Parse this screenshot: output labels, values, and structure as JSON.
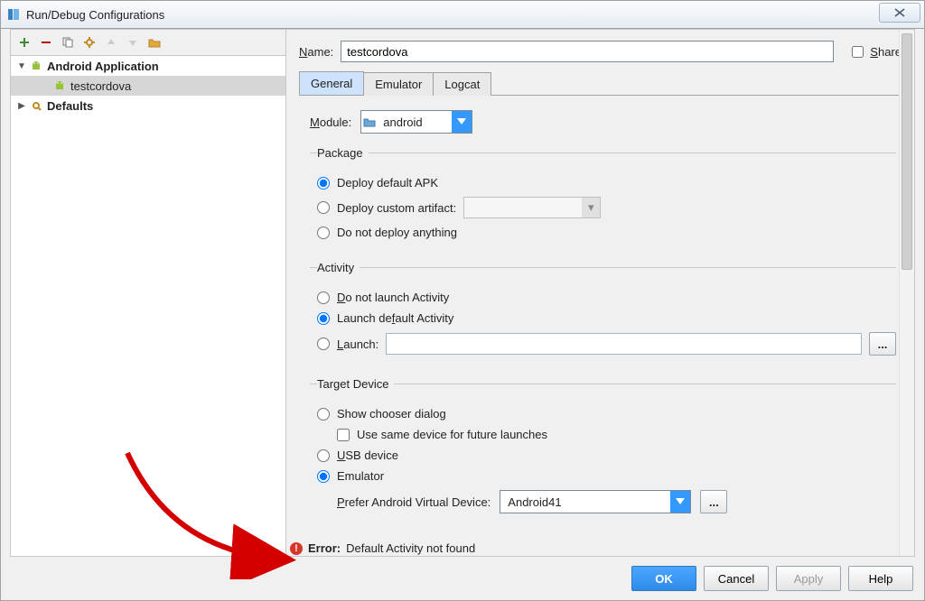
{
  "window": {
    "title": "Run/Debug Configurations"
  },
  "toolbar_icons": [
    "add",
    "remove",
    "copy",
    "save",
    "up",
    "down",
    "folder"
  ],
  "tree": {
    "items": [
      {
        "label": "Android Application",
        "icon": "android",
        "bold": true
      },
      {
        "label": "testcordova",
        "icon": "android",
        "selected": true
      },
      {
        "label": "Defaults",
        "icon": "wrench"
      }
    ]
  },
  "form": {
    "name_label": "Name:",
    "name_value": "testcordova",
    "share_label": "Share",
    "tabs": [
      "General",
      "Emulator",
      "Logcat"
    ],
    "module_label": "Module:",
    "module_value": "android",
    "package": {
      "legend": "Package",
      "opt1": "Deploy default APK",
      "opt2": "Deploy custom artifact:",
      "opt3": "Do not deploy anything"
    },
    "activity": {
      "legend": "Activity",
      "opt1": "Do not launch Activity",
      "opt2": "Launch default Activity",
      "opt3": "Launch:"
    },
    "target": {
      "legend": "Target Device",
      "opt1": "Show chooser dialog",
      "opt1_sub": "Use same device for future launches",
      "opt2": "USB device",
      "opt3": "Emulator",
      "prefer_label": "Prefer Android Virtual Device:",
      "prefer_value": "Android41"
    }
  },
  "error": {
    "label": "Error:",
    "message": "Default Activity not found"
  },
  "buttons": {
    "ok": "OK",
    "cancel": "Cancel",
    "apply": "Apply",
    "help": "Help"
  }
}
